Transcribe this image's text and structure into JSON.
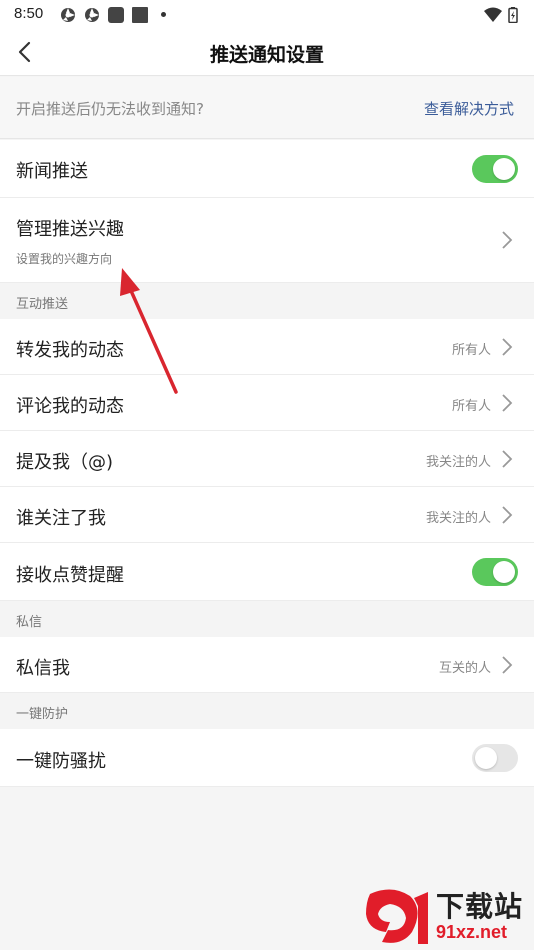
{
  "status_bar": {
    "time": "8:50"
  },
  "header": {
    "title": "推送通知设置"
  },
  "tip": {
    "text": "开启推送后仍无法收到通知?",
    "link": "查看解决方式"
  },
  "rows": {
    "news_push": {
      "label": "新闻推送",
      "toggle": "on"
    },
    "manage_interest": {
      "label": "管理推送兴趣",
      "sub": "设置我的兴趣方向"
    },
    "repost": {
      "label": "转发我的动态",
      "value": "所有人"
    },
    "comment": {
      "label": "评论我的动态",
      "value": "所有人"
    },
    "mention": {
      "label": "提及我（@)",
      "value": "我关注的人"
    },
    "follow": {
      "label": "谁关注了我",
      "value": "我关注的人"
    },
    "likes": {
      "label": "接收点赞提醒",
      "toggle": "on"
    },
    "dm": {
      "label": "私信我",
      "value": "互关的人"
    },
    "anti_harass": {
      "label": "一键防骚扰",
      "toggle": "off"
    }
  },
  "sections": {
    "interaction": "互动推送",
    "private": "私信",
    "protect": "一键防护"
  },
  "watermark": {
    "line1": "下载站",
    "line2": "91xz.net"
  },
  "colors": {
    "toggle_on": "#5ac85c",
    "link": "#3b5c99",
    "annotation_arrow": "#d9262f",
    "watermark_red": "#e11d2a"
  }
}
